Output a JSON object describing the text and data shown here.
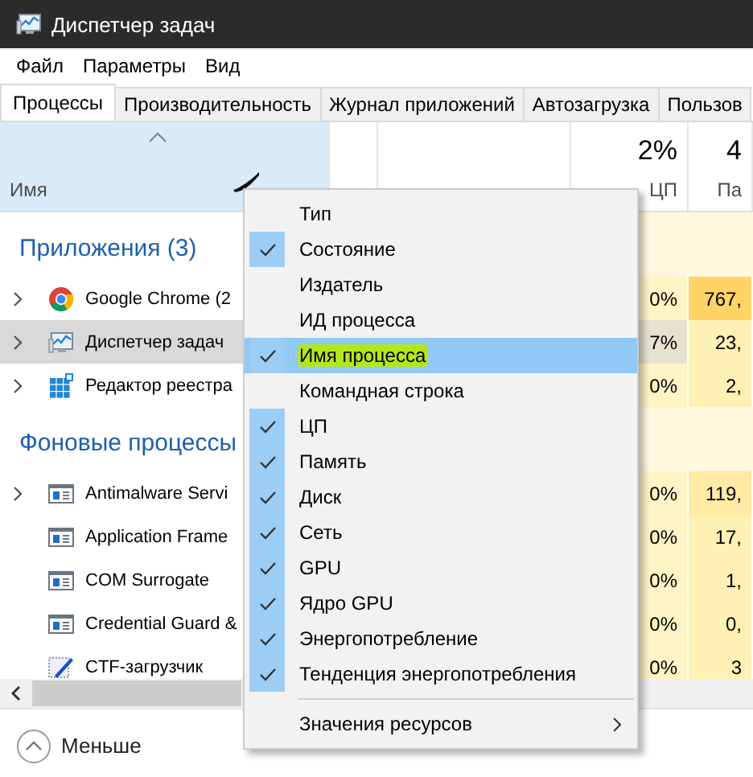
{
  "window": {
    "title": "Диспетчер задач"
  },
  "menu_bar": [
    "Файл",
    "Параметры",
    "Вид"
  ],
  "tabs": [
    {
      "label": "Процессы",
      "selected": true
    },
    {
      "label": "Производительность",
      "selected": false
    },
    {
      "label": "Журнал приложений",
      "selected": false
    },
    {
      "label": "Автозагрузка",
      "selected": false
    },
    {
      "label": "Пользов",
      "selected": false
    }
  ],
  "table": {
    "columns": [
      {
        "label": "Имя",
        "hovered": true
      },
      {
        "percent": "2%",
        "label": "ЦП",
        "hovered": false
      },
      {
        "percent": "4",
        "label": "Па",
        "hovered": false
      }
    ],
    "groups": [
      {
        "title": "Приложения (3)",
        "rows": [
          {
            "kind": "browser",
            "name": "Google Chrome (2",
            "expandable": true,
            "selected": false,
            "cpu": "0%",
            "memory": {
              "value": "767,",
              "color": "#ffd466"
            }
          },
          {
            "kind": "monitor",
            "name": "Диспетчер задач",
            "expandable": true,
            "selected": true,
            "cpu": "7%",
            "memory": {
              "value": "23,",
              "color": "#fff0b4"
            }
          },
          {
            "kind": "registry",
            "name": "Редактор реестра",
            "expandable": true,
            "selected": false,
            "cpu": "0%",
            "memory": {
              "value": "2,",
              "color": "#fff0b4"
            }
          }
        ]
      },
      {
        "title": "Фоновые процессы",
        "rows": [
          {
            "kind": "window",
            "name": "Antimalware Servi",
            "expandable": true,
            "selected": false,
            "cpu": "0%",
            "memory": {
              "value": "119,",
              "color": "#ffe9a3"
            }
          },
          {
            "kind": "window",
            "name": "Application Frame",
            "expandable": false,
            "selected": false,
            "cpu": "0%",
            "memory": {
              "value": "17,",
              "color": "#fff0b4"
            }
          },
          {
            "kind": "window",
            "name": "COM Surrogate",
            "expandable": false,
            "selected": false,
            "cpu": "0%",
            "memory": {
              "value": "1,",
              "color": "#fff0b4"
            }
          },
          {
            "kind": "window",
            "name": "Credential Guard &",
            "expandable": false,
            "selected": false,
            "cpu": "0%",
            "memory": {
              "value": "0,",
              "color": "#fff0b4"
            }
          },
          {
            "kind": "pen",
            "name": "CTF-загрузчик",
            "expandable": false,
            "selected": false,
            "cpu": "0%",
            "memory": {
              "value": "3",
              "color": "#fff0b4"
            }
          }
        ]
      }
    ]
  },
  "context_menu": {
    "items": [
      {
        "kind": "item",
        "label": "Тип",
        "checked": false,
        "selected": false,
        "marked": false
      },
      {
        "kind": "item",
        "label": "Состояние",
        "checked": true,
        "selected": false,
        "marked": false
      },
      {
        "kind": "item",
        "label": "Издатель",
        "checked": false,
        "selected": false,
        "marked": false
      },
      {
        "kind": "item",
        "label": "ИД процесса",
        "checked": false,
        "selected": false,
        "marked": false
      },
      {
        "kind": "item",
        "label": "Имя процесса",
        "checked": true,
        "selected": true,
        "marked": true
      },
      {
        "kind": "item",
        "label": "Командная строка",
        "checked": false,
        "selected": false,
        "marked": false
      },
      {
        "kind": "item",
        "label": "ЦП",
        "checked": true,
        "selected": false,
        "marked": false
      },
      {
        "kind": "item",
        "label": "Память",
        "checked": true,
        "selected": false,
        "marked": false
      },
      {
        "kind": "item",
        "label": "Диск",
        "checked": true,
        "selected": false,
        "marked": false
      },
      {
        "kind": "item",
        "label": "Сеть",
        "checked": true,
        "selected": false,
        "marked": false
      },
      {
        "kind": "item",
        "label": "GPU",
        "checked": true,
        "selected": false,
        "marked": false
      },
      {
        "kind": "item",
        "label": "Ядро GPU",
        "checked": true,
        "selected": false,
        "marked": false
      },
      {
        "kind": "item",
        "label": "Энергопотребление",
        "checked": true,
        "selected": false,
        "marked": false
      },
      {
        "kind": "item",
        "label": "Тенденция энергопотребления",
        "checked": true,
        "selected": false,
        "marked": false
      },
      {
        "kind": "separator"
      },
      {
        "kind": "submenu",
        "label": "Значения ресурсов",
        "checked": false,
        "selected": false,
        "marked": false
      }
    ]
  },
  "footer": {
    "label": "Меньше"
  }
}
